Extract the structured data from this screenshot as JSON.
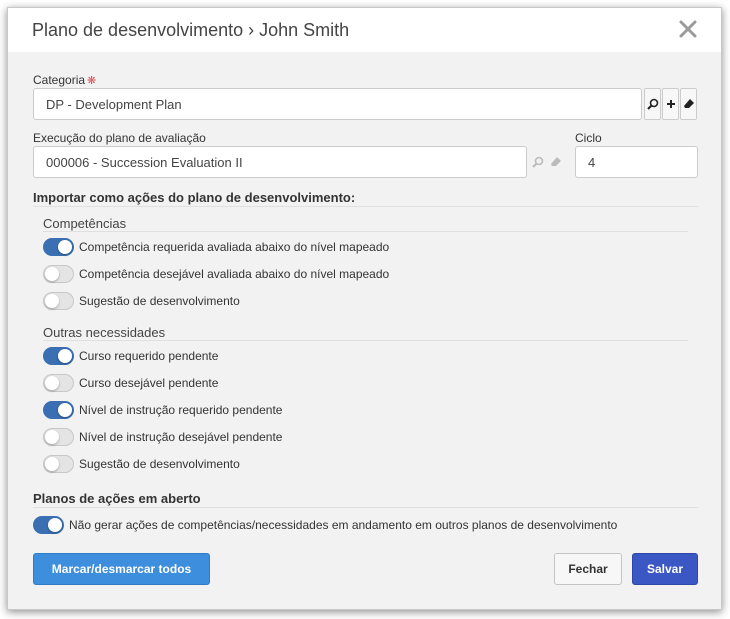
{
  "dialog": {
    "title": "Plano de desenvolvimento › John Smith"
  },
  "categoria": {
    "label": "Categoria",
    "value": "DP - Development Plan"
  },
  "execucao": {
    "label": "Execução do plano de avaliação",
    "value": "000006 - Succession Evaluation II"
  },
  "ciclo": {
    "label": "Ciclo",
    "value": "4"
  },
  "importar": {
    "title": "Importar como ações do plano de desenvolvimento:",
    "competencias": {
      "title": "Competências",
      "items": [
        {
          "label": "Competência requerida avaliada abaixo do nível mapeado",
          "on": true
        },
        {
          "label": "Competência desejável avaliada abaixo do nível mapeado",
          "on": false
        },
        {
          "label": "Sugestão de desenvolvimento",
          "on": false
        }
      ]
    },
    "outras": {
      "title": "Outras necessidades",
      "items": [
        {
          "label": "Curso requerido pendente",
          "on": true
        },
        {
          "label": "Curso desejável pendente",
          "on": false
        },
        {
          "label": "Nível de instrução requerido pendente",
          "on": true
        },
        {
          "label": "Nível de instrução desejável pendente",
          "on": false
        },
        {
          "label": "Sugestão de desenvolvimento",
          "on": false
        }
      ]
    }
  },
  "planos": {
    "title": "Planos de ações em aberto",
    "item": {
      "label": "Não gerar ações de competências/necessidades em andamento em outros planos de desenvolvimento",
      "on": true
    }
  },
  "buttons": {
    "toggle_all": "Marcar/desmarcar todos",
    "close": "Fechar",
    "save": "Salvar"
  },
  "icons": {
    "close": "close-icon",
    "search": "search-icon",
    "add": "plus-icon",
    "clear": "eraser-icon"
  },
  "colors": {
    "toggle_on": "#3a6fb3",
    "primary": "#3d8fdd",
    "save": "#3b57c4",
    "required": "#d9534f"
  }
}
